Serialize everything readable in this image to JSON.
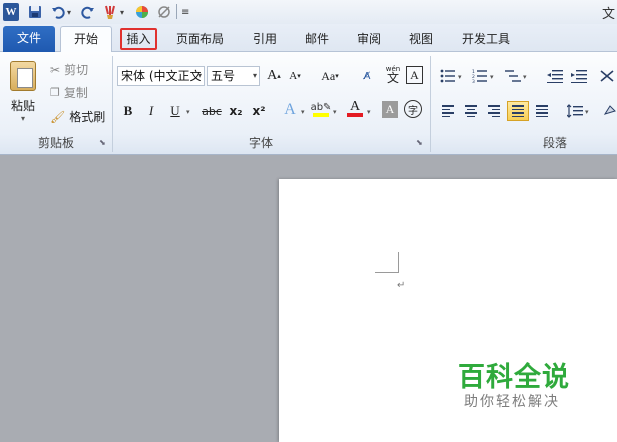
{
  "app": {
    "logo_letter": "W"
  },
  "qat": {
    "icons": [
      "save-icon",
      "undo-icon",
      "redo-icon",
      "format-painter-icon",
      "color-icon",
      "no-format-icon",
      "customize-icon"
    ],
    "truncated_right": "文"
  },
  "tabs": [
    {
      "label": "文件"
    },
    {
      "label": "开始"
    },
    {
      "label": "插入"
    },
    {
      "label": "页面布局"
    },
    {
      "label": "引用"
    },
    {
      "label": "邮件"
    },
    {
      "label": "审阅"
    },
    {
      "label": "视图"
    },
    {
      "label": "开发工具"
    }
  ],
  "clipboard": {
    "paste_label": "粘贴",
    "cut_label": "剪切",
    "copy_label": "复制",
    "format_painter_label": "格式刷",
    "group_label": "剪贴板"
  },
  "font": {
    "font_name": "宋体 (中文正文",
    "font_size": "五号",
    "group_label": "字体",
    "bold": "B",
    "italic": "I",
    "underline": "U",
    "strikethrough": "abc",
    "subscript": "x₂",
    "superscript": "x²",
    "change_case": "Aa",
    "grow": "A",
    "shrink": "A",
    "phonetic": "wén",
    "phonetic_char": "文",
    "border_char": "A",
    "enclose_char": "字",
    "highlight_color": "#ffff00",
    "font_color": "#e31b23"
  },
  "paragraph": {
    "group_label": "段落"
  },
  "document": {
    "paragraph_mark": "↵"
  },
  "watermark": {
    "title": "百科全说",
    "subtitle": "助你轻松解决"
  }
}
